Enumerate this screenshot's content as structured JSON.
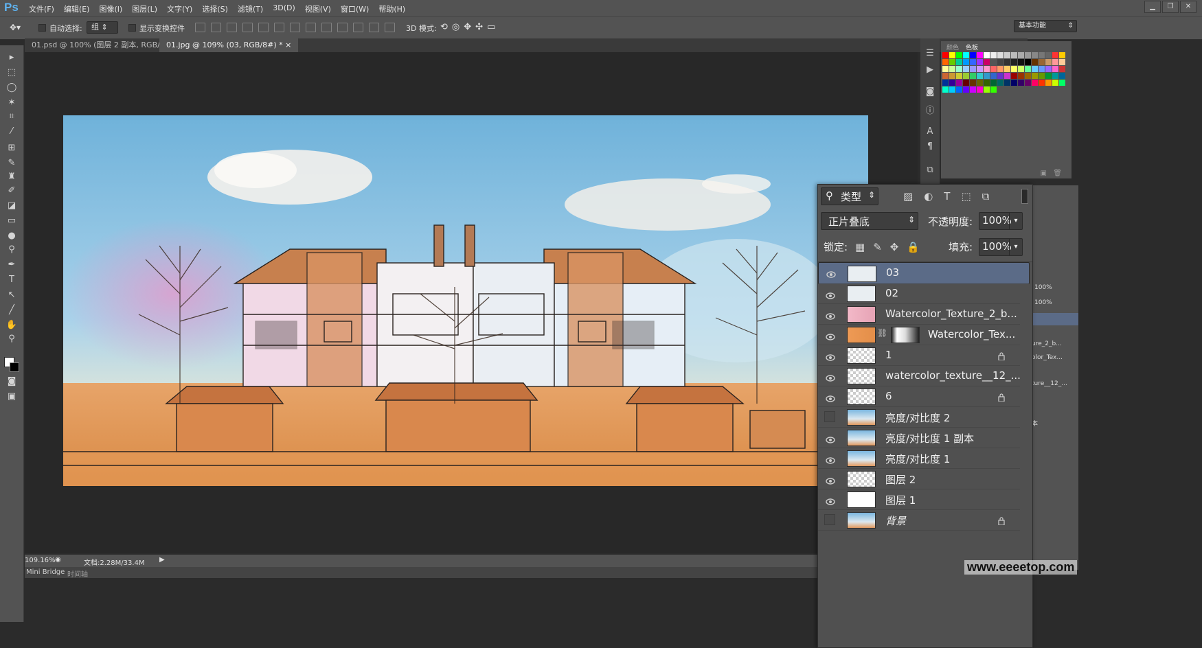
{
  "app": {
    "logo": "Ps"
  },
  "menu": [
    "文件(F)",
    "编辑(E)",
    "图像(I)",
    "图层(L)",
    "文字(Y)",
    "选择(S)",
    "滤镜(T)",
    "3D(D)",
    "视图(V)",
    "窗口(W)",
    "帮助(H)"
  ],
  "options": {
    "auto_select_label": "自动选择:",
    "auto_select_value": "组",
    "show_transform_label": "显示变换控件",
    "mode_3d_label": "3D 模式:",
    "workspace": "基本功能"
  },
  "tabs": [
    {
      "label": "01.psd @ 100% (图层 2 副本, RGB/8#) *",
      "active": false
    },
    {
      "label": "01.jpg @ 109% (03, RGB/8#) *",
      "active": true
    }
  ],
  "status": {
    "zoom": "109.16%",
    "doc": "文档:2.28M/33.4M"
  },
  "bottom_tabs": [
    "Mini Bridge",
    "时间轴"
  ],
  "swatch_tabs": [
    "颜色",
    "色板"
  ],
  "layers_panel": {
    "filter_label": "类型",
    "blend_mode": "正片叠底",
    "opacity_label": "不透明度:",
    "opacity_value": "100%",
    "lock_label": "锁定:",
    "fill_label": "填充:",
    "fill_value": "100%",
    "layers": [
      {
        "name": "03",
        "visible": true,
        "selected": true,
        "locked": false
      },
      {
        "name": "02",
        "visible": true,
        "selected": false,
        "locked": false
      },
      {
        "name": "Watercolor_Texture_2_b...",
        "visible": true,
        "selected": false,
        "locked": false
      },
      {
        "name": "Watercolor_Tex...",
        "visible": true,
        "selected": false,
        "locked": false
      },
      {
        "name": "1",
        "visible": true,
        "selected": false,
        "locked": true
      },
      {
        "name": "watercolor_texture__12_...",
        "visible": true,
        "selected": false,
        "locked": false
      },
      {
        "name": "6",
        "visible": true,
        "selected": false,
        "locked": true
      },
      {
        "name": "亮度/对比度 2",
        "visible": false,
        "selected": false,
        "locked": false
      },
      {
        "name": "亮度/对比度 1 副本",
        "visible": true,
        "selected": false,
        "locked": false
      },
      {
        "name": "亮度/对比度 1",
        "visible": true,
        "selected": false,
        "locked": false
      },
      {
        "name": "图层 2",
        "visible": true,
        "selected": false,
        "locked": false
      },
      {
        "name": "图层 1",
        "visible": true,
        "selected": false,
        "locked": false
      },
      {
        "name": "背景",
        "visible": false,
        "selected": false,
        "locked": true
      }
    ]
  },
  "back_panel": {
    "values": [
      "100%",
      "100%"
    ],
    "partial_names": [
      "ure_2_b...",
      "olor_Tex...",
      "ture__12_...",
      "本"
    ]
  },
  "watermark": "www.eeeetop.com",
  "colors": {
    "accent": "#5fb3f0",
    "selected_row": "#5b6b87",
    "panel": "#535353",
    "dark": "#282828"
  }
}
